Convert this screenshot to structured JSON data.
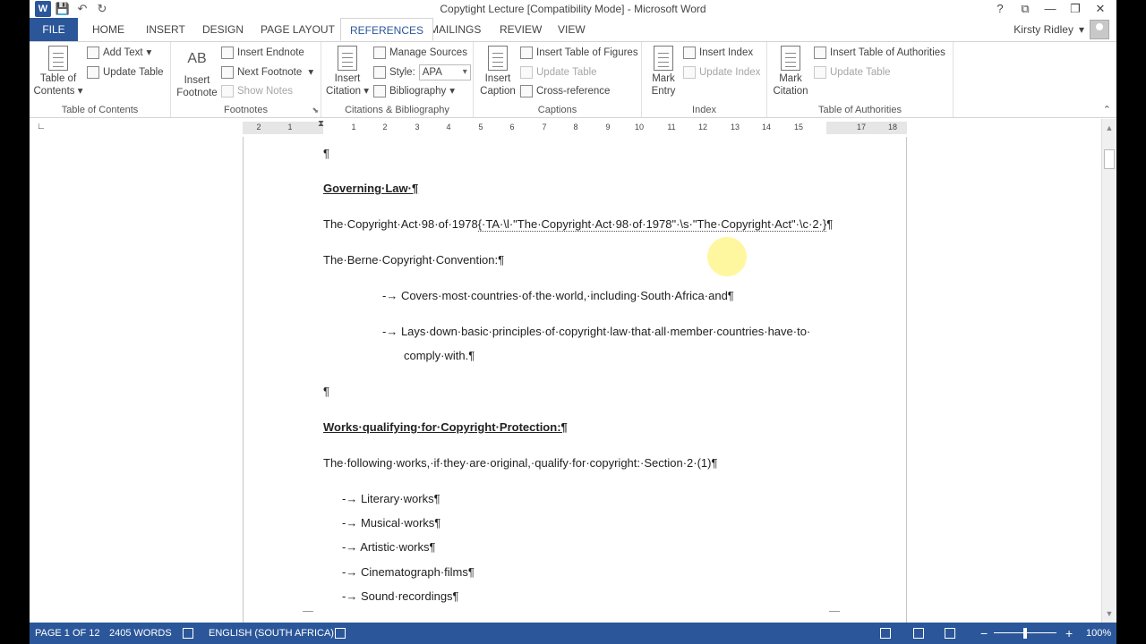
{
  "window": {
    "title": "Copytight Lecture [Compatibility Mode] - Microsoft Word",
    "controls": [
      "?",
      "⧉",
      "—",
      "❐",
      "✕"
    ]
  },
  "qat": {
    "app_icon": "W",
    "save": "💾",
    "undo": "↶",
    "redo": "↻"
  },
  "tabs": [
    "FILE",
    "HOME",
    "INSERT",
    "DESIGN",
    "PAGE LAYOUT",
    "REFERENCES",
    "MAILINGS",
    "REVIEW",
    "VIEW"
  ],
  "active_tab": "REFERENCES",
  "user": {
    "name": "Kirsty Ridley"
  },
  "ribbon": {
    "toc": {
      "label": "Table of Contents",
      "btn_line1": "Table of",
      "btn_line2": "Contents",
      "add_text": "Add Text",
      "update_table": "Update Table"
    },
    "footnotes": {
      "label": "Footnotes",
      "insert_line1": "Insert",
      "insert_line2": "Footnote",
      "insert_endnote": "Insert Endnote",
      "next_footnote": "Next Footnote",
      "show_notes": "Show Notes",
      "icon_text": "AB"
    },
    "citations": {
      "label": "Citations & Bibliography",
      "insert_line1": "Insert",
      "insert_line2": "Citation",
      "manage_sources": "Manage Sources",
      "style_label": "Style:",
      "style_value": "APA",
      "bibliography": "Bibliography"
    },
    "captions": {
      "label": "Captions",
      "insert_line1": "Insert",
      "insert_line2": "Caption",
      "insert_tof": "Insert Table of Figures",
      "update_table": "Update Table",
      "cross_reference": "Cross-reference"
    },
    "index": {
      "label": "Index",
      "mark_line1": "Mark",
      "mark_line2": "Entry",
      "insert_index": "Insert Index",
      "update_index": "Update Index"
    },
    "toa": {
      "label": "Table of Authorities",
      "mark_line1": "Mark",
      "mark_line2": "Citation",
      "insert_toa": "Insert Table of Authorities",
      "update_table": "Update Table"
    }
  },
  "ruler": {
    "ticks": [
      "2",
      "1",
      "1",
      "2",
      "3",
      "4",
      "5",
      "6",
      "7",
      "8",
      "9",
      "10",
      "11",
      "12",
      "13",
      "14",
      "15",
      "17",
      "18"
    ]
  },
  "document": {
    "p1": "¶",
    "heading1": "Governing·Law·¶",
    "p2_text": "The·Copyright·Act·98·of·1978",
    "p2_field": "{·TA·\\l·\"The·Copyright·Act·98·of·1978\"·\\s·\"The·Copyright·Act\"·\\c·2·}",
    "p2_end": "¶",
    "p3": "The·Berne·Copyright·Convention:¶",
    "b1": "-→ Covers·most·countries·of·the·world,·including·South·Africa·and¶",
    "b2_line1": "-→ Lays·down·basic·principles·of·copyright·law·that·all·member·countries·have·to·",
    "b2_line2": "comply·with.¶",
    "p4": "¶",
    "heading2": "Works·qualifying·for·Copyright·Protection:¶",
    "p5": "The·following·works,·if·they·are·original,·qualify·for·copyright:·Section·2·(1)¶",
    "list": [
      "-→ Literary·works¶",
      "-→ Musical·works¶",
      "-→ Artistic·works¶",
      "-→ Cinematograph·films¶",
      "-→ Sound·recordings¶"
    ]
  },
  "status": {
    "page": "PAGE 1 OF 12",
    "words": "2405 WORDS",
    "language": "ENGLISH (SOUTH AFRICA)",
    "zoom_minus": "−",
    "zoom_plus": "+",
    "zoom": "100%",
    "zoom_level_percent": 100
  },
  "colors": {
    "accent": "#2b579a"
  }
}
